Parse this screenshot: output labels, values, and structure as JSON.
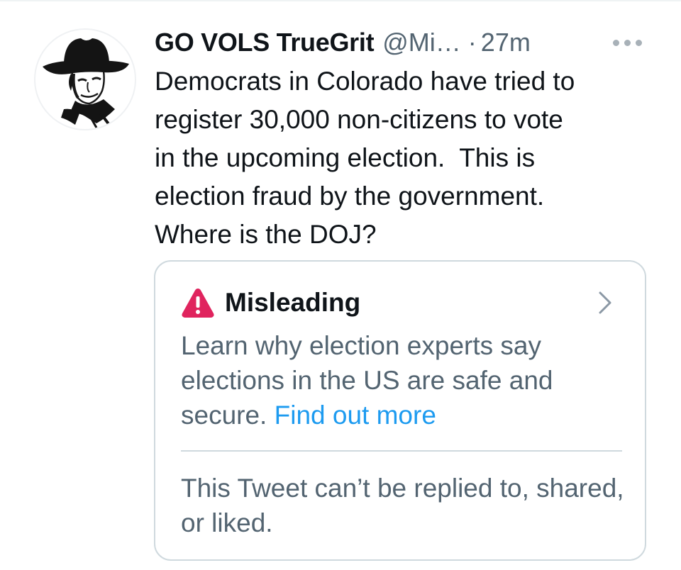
{
  "tweet": {
    "author": {
      "display_name": "GO VOLS TrueGrit",
      "handle": "@Mi…",
      "avatar": "cowboy-hat-portrait"
    },
    "separator": "·",
    "timestamp": "27m",
    "more_icon": "more-horizontal-icon",
    "text": "Democrats in Colorado have tried to\nregister 30,000 non-citizens to vote\nin the upcoming election.  This is\nelection fraud by the government.\nWhere is the DOJ?",
    "notice": {
      "icon": "warning-triangle-icon",
      "title": "Misleading",
      "description": "Learn why election experts say elections in the US are safe and secure.",
      "link_label": "Find out more",
      "chevron_icon": "chevron-right-icon",
      "restriction": "This Tweet can’t be replied to, shared, or liked."
    }
  },
  "colors": {
    "primary_text": "#0f1419",
    "secondary_text": "#536471",
    "link": "#1d9bf0",
    "warning": "#e0245e",
    "border": "#cfd9de"
  }
}
